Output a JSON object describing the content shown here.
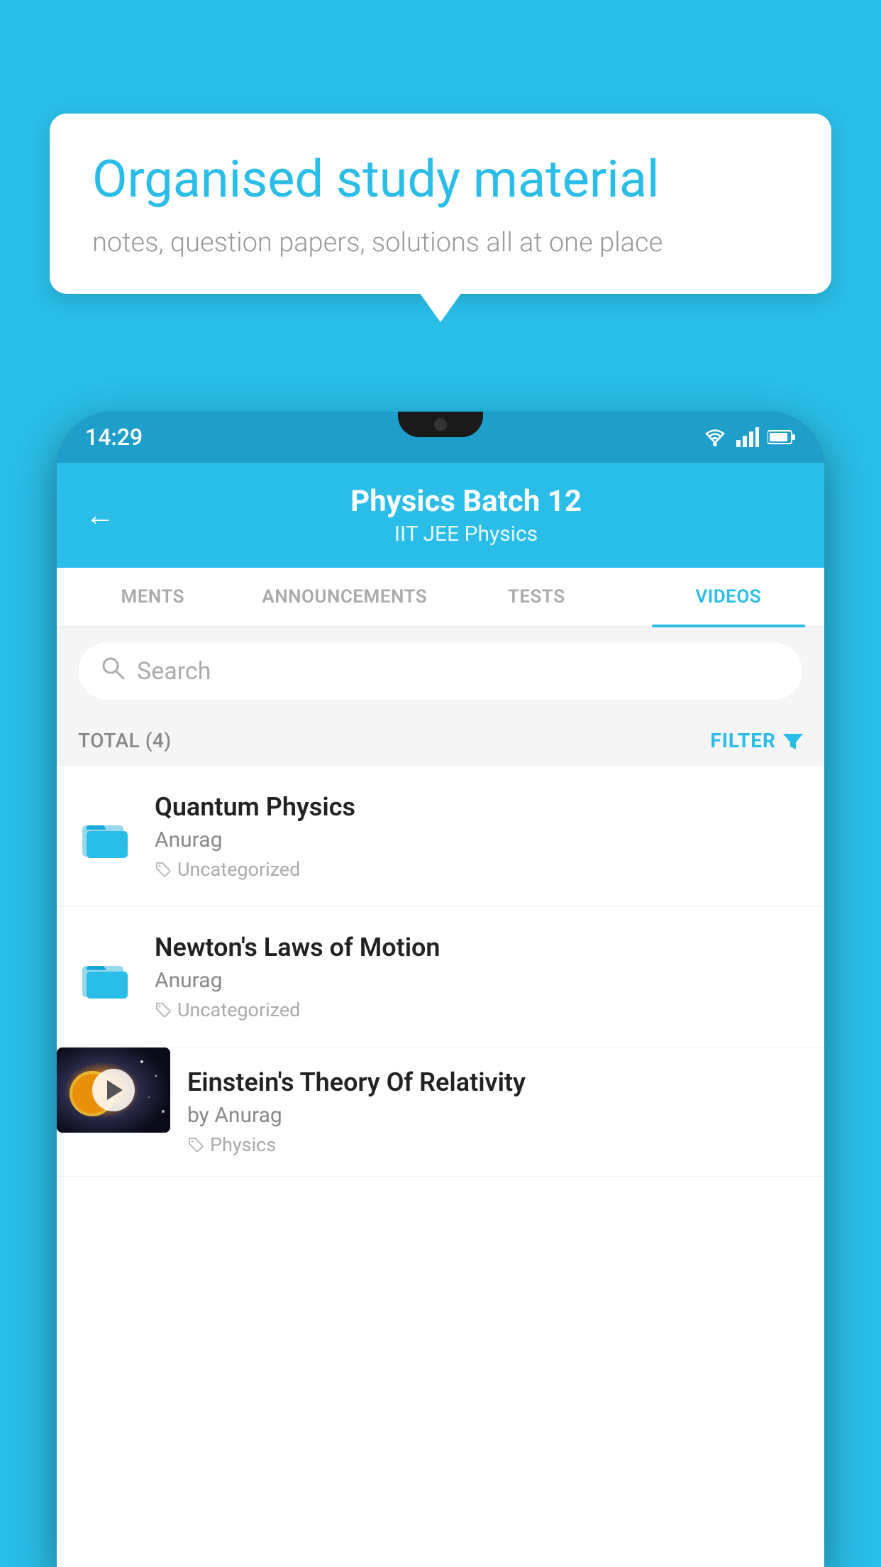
{
  "background_color": "#29bde8",
  "speech_bubble": {
    "title": "Organised study material",
    "subtitle": "notes, question papers, solutions all at one place"
  },
  "phone": {
    "status_bar": {
      "time": "14:29",
      "icons": [
        "wifi",
        "signal",
        "battery"
      ]
    },
    "header": {
      "back_label": "←",
      "title": "Physics Batch 12",
      "subtitle": "IIT JEE   Physics"
    },
    "tabs": [
      {
        "label": "MENTS",
        "active": false
      },
      {
        "label": "ANNOUNCEMENTS",
        "active": false
      },
      {
        "label": "TESTS",
        "active": false
      },
      {
        "label": "VIDEOS",
        "active": true
      }
    ],
    "search": {
      "placeholder": "Search"
    },
    "filter_bar": {
      "total_label": "TOTAL (4)",
      "filter_label": "FILTER"
    },
    "videos": [
      {
        "id": 1,
        "title": "Quantum Physics",
        "author": "Anurag",
        "tag": "Uncategorized",
        "type": "folder",
        "has_thumbnail": false
      },
      {
        "id": 2,
        "title": "Newton's Laws of Motion",
        "author": "Anurag",
        "tag": "Uncategorized",
        "type": "folder",
        "has_thumbnail": false
      },
      {
        "id": 3,
        "title": "Einstein's Theory Of Relativity",
        "author": "by Anurag",
        "tag": "Physics",
        "type": "video",
        "has_thumbnail": true
      }
    ]
  }
}
